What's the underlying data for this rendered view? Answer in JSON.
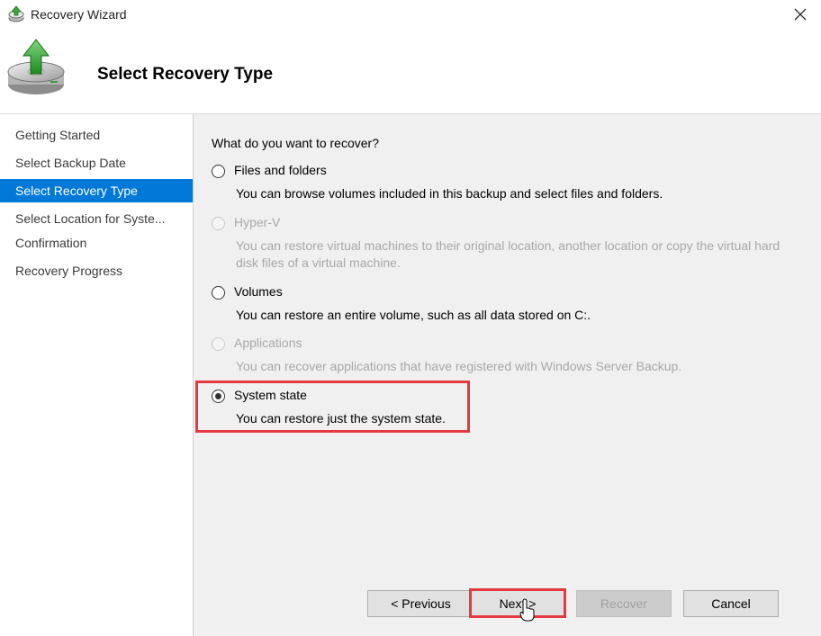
{
  "window": {
    "title": "Recovery Wizard",
    "close_glyph": "✕"
  },
  "header": {
    "title": "Select Recovery Type",
    "icon": "backup-restore-icon"
  },
  "steps": [
    {
      "label": "Getting Started",
      "active": false
    },
    {
      "label": "Select Backup Date",
      "active": false
    },
    {
      "label": "Select Recovery Type",
      "active": true
    },
    {
      "label": "Select Location for Syste...",
      "active": false
    },
    {
      "label": "Confirmation",
      "active": false
    },
    {
      "label": "Recovery Progress",
      "active": false
    }
  ],
  "main": {
    "question": "What do you want to recover?",
    "options": [
      {
        "label": "Files and folders",
        "description": "You can browse volumes included in this backup and select files and folders.",
        "enabled": true,
        "selected": false
      },
      {
        "label": "Hyper-V",
        "description": "You can restore virtual machines to their original location, another location or copy the virtual hard disk files of a virtual machine.",
        "enabled": false,
        "selected": false
      },
      {
        "label": "Volumes",
        "description": "You can restore an entire volume, such as all data stored on C:.",
        "enabled": true,
        "selected": false
      },
      {
        "label": "Applications",
        "description": "You can recover applications that have registered with Windows Server Backup.",
        "enabled": false,
        "selected": false
      },
      {
        "label": "System state",
        "description": "You can restore just the system state.",
        "enabled": true,
        "selected": true
      }
    ]
  },
  "buttons": {
    "previous": "< Previous",
    "next": "Next >",
    "recover": "Recover",
    "cancel": "Cancel"
  },
  "colors": {
    "accent": "#0078d7",
    "highlight": "#e6393f"
  }
}
